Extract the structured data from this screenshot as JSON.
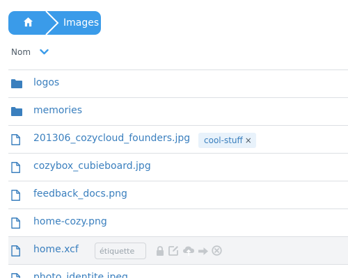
{
  "breadcrumb": {
    "home_icon": "home-icon",
    "current": "Images"
  },
  "sort": {
    "label": "Nom",
    "direction_icon": "chevron-down-icon"
  },
  "colors": {
    "accent": "#3a9be9",
    "link": "#3a7fbe",
    "border": "#dcdfe3",
    "hover_row": "#f3f4f6",
    "action_icon": "#c4c8cc"
  },
  "files": [
    {
      "type": "folder",
      "name": "logos"
    },
    {
      "type": "folder",
      "name": "memories"
    },
    {
      "type": "file",
      "name": "201306_cozycloud_founders.jpg",
      "tag": "cool-stuff"
    },
    {
      "type": "file",
      "name": "cozybox_cubieboard.jpg"
    },
    {
      "type": "file",
      "name": "feedback_docs.png"
    },
    {
      "type": "file",
      "name": "home-cozy.png"
    },
    {
      "type": "file",
      "name": "home.xcf",
      "hovered": true
    },
    {
      "type": "file",
      "name": "photo_identite.jpeg"
    }
  ],
  "tag_remove": "×",
  "tag_input": {
    "placeholder": "étiquette"
  },
  "row_actions": [
    {
      "icon": "lock-icon"
    },
    {
      "icon": "edit-icon"
    },
    {
      "icon": "cloud-upload-icon"
    },
    {
      "icon": "move-arrow-icon"
    },
    {
      "icon": "delete-circle-icon"
    }
  ]
}
